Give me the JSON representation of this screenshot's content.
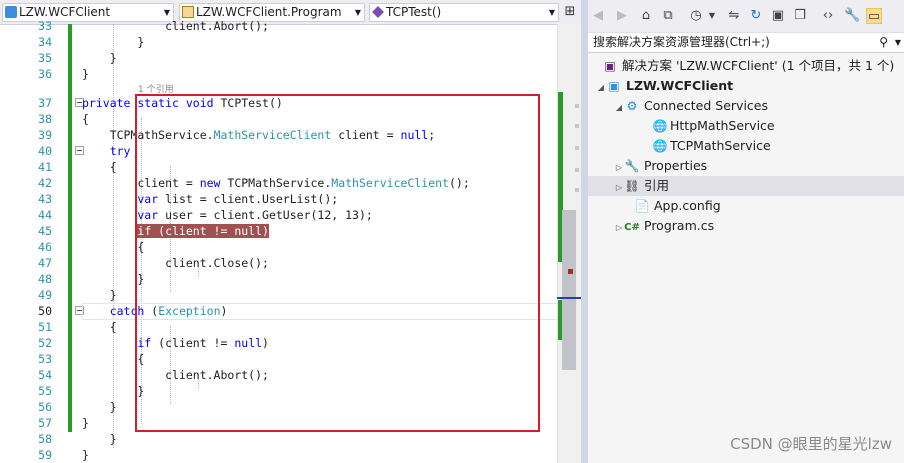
{
  "editor": {
    "nav": {
      "project": "LZW.WCFClient",
      "class": "LZW.WCFClient.Program",
      "member": "TCPTest()"
    },
    "codelens": "1 个引用",
    "lines": [
      {
        "n": "33",
        "segs": [
          [
            "",
            "            "
          ],
          [
            "",
            "client."
          ],
          [
            "",
            "Abort"
          ],
          [
            "",
            "();"
          ]
        ]
      },
      {
        "n": "34",
        "segs": [
          [
            "",
            "        }"
          ]
        ]
      },
      {
        "n": "35",
        "segs": [
          [
            "",
            "    }"
          ]
        ]
      },
      {
        "n": "36",
        "segs": [
          [
            "",
            "}"
          ]
        ]
      },
      {
        "n": "37",
        "segs": [
          [
            "kw",
            "private static void "
          ],
          [
            "",
            "TCPTest()"
          ]
        ]
      },
      {
        "n": "38",
        "segs": [
          [
            "",
            "{"
          ]
        ]
      },
      {
        "n": "39",
        "segs": [
          [
            "",
            "    TCPMathService."
          ],
          [
            "ty",
            "MathServiceClient"
          ],
          [
            "",
            " client = "
          ],
          [
            "kw",
            "null"
          ],
          [
            "",
            ";"
          ]
        ]
      },
      {
        "n": "40",
        "segs": [
          [
            "kw",
            "    try"
          ]
        ]
      },
      {
        "n": "41",
        "segs": [
          [
            "",
            "    {"
          ]
        ]
      },
      {
        "n": "42",
        "segs": [
          [
            "",
            "        client = "
          ],
          [
            "kw",
            "new "
          ],
          [
            "",
            "TCPMathService."
          ],
          [
            "ty",
            "MathServiceClient"
          ],
          [
            "",
            "();"
          ]
        ]
      },
      {
        "n": "43",
        "segs": [
          [
            "kw",
            "        var "
          ],
          [
            "",
            "list = client.UserList();"
          ]
        ]
      },
      {
        "n": "44",
        "segs": [
          [
            "kw",
            "        var "
          ],
          [
            "",
            "user = client.GetUser(12, 13);"
          ]
        ]
      },
      {
        "n": "45",
        "segs": [
          [
            "",
            "        "
          ],
          [
            "hl",
            "if (client != null)"
          ]
        ]
      },
      {
        "n": "46",
        "segs": [
          [
            "",
            "        {"
          ]
        ]
      },
      {
        "n": "47",
        "segs": [
          [
            "",
            "            client.Close();"
          ]
        ]
      },
      {
        "n": "48",
        "segs": [
          [
            "",
            "        }"
          ]
        ]
      },
      {
        "n": "49",
        "segs": [
          [
            "",
            "    }"
          ]
        ]
      },
      {
        "n": "50",
        "segs": [
          [
            "kw",
            "    catch "
          ],
          [
            "",
            "("
          ],
          [
            "ty",
            "Exception"
          ],
          [
            "",
            ")"
          ]
        ]
      },
      {
        "n": "51",
        "segs": [
          [
            "",
            "    {"
          ]
        ]
      },
      {
        "n": "52",
        "segs": [
          [
            "kw",
            "        if "
          ],
          [
            "",
            "(client != "
          ],
          [
            "kw",
            "null"
          ],
          [
            "",
            ")"
          ]
        ]
      },
      {
        "n": "53",
        "segs": [
          [
            "",
            "        {"
          ]
        ]
      },
      {
        "n": "54",
        "segs": [
          [
            "",
            "            client.Abort();"
          ]
        ]
      },
      {
        "n": "55",
        "segs": [
          [
            "",
            "        }"
          ]
        ]
      },
      {
        "n": "56",
        "segs": [
          [
            "",
            "    }"
          ]
        ]
      },
      {
        "n": "57",
        "segs": [
          [
            "",
            "}"
          ]
        ]
      },
      {
        "n": "58",
        "segs": [
          [
            "",
            "    }"
          ]
        ]
      },
      {
        "n": "59",
        "segs": [
          [
            "",
            "}"
          ]
        ]
      }
    ]
  },
  "solution_explorer": {
    "search_placeholder": "搜索解决方案资源管理器(Ctrl+;)",
    "solution_label": "解决方案 'LZW.WCFClient' (1 个项目，共 1 个)",
    "project": "LZW.WCFClient",
    "connected_services": "Connected Services",
    "http_service": "HttpMathService",
    "tcp_service": "TCPMathService",
    "properties": "Properties",
    "references": "引用",
    "app_config": "App.config",
    "program_cs": "Program.cs"
  },
  "watermark": "CSDN @眼里的星光lzw",
  "colors": {
    "keyword": "#0000ff",
    "type": "#2b91af",
    "highlight": "#a05050",
    "changes": "#2b9a2b",
    "box": "#d01f2a"
  }
}
